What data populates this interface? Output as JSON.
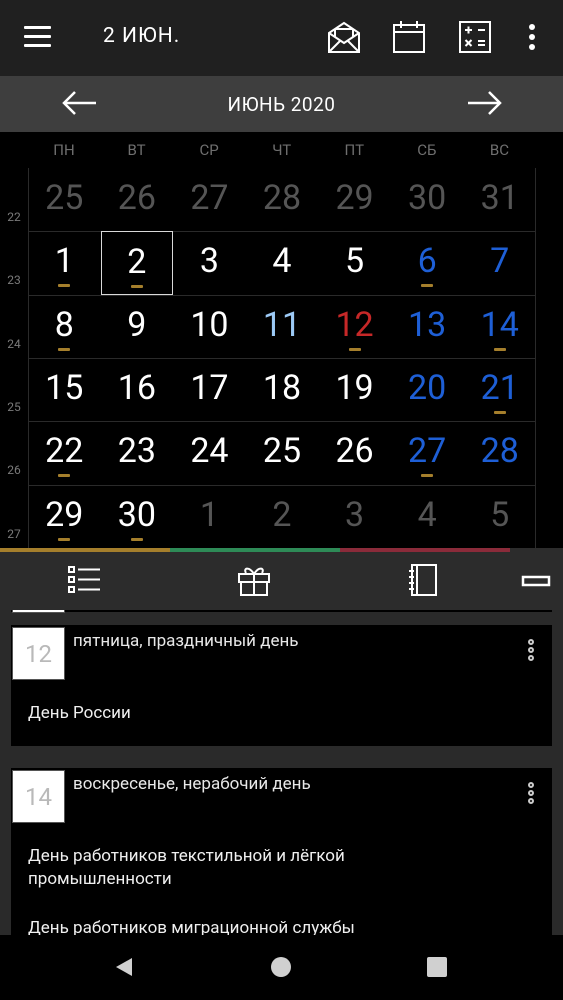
{
  "header": {
    "date": "2 ИЮН."
  },
  "month_bar": {
    "title": "ИЮНЬ 2020"
  },
  "weekdays": [
    "ПН",
    "ВТ",
    "СР",
    "ЧТ",
    "ПТ",
    "СБ",
    "ВС"
  ],
  "week_numbers": [
    "22",
    "23",
    "24",
    "25",
    "26",
    "27"
  ],
  "calendar": {
    "rows": [
      [
        "25",
        "26",
        "27",
        "28",
        "29",
        "30",
        "31"
      ],
      [
        "1",
        "2",
        "3",
        "4",
        "5",
        "6",
        "7"
      ],
      [
        "8",
        "9",
        "10",
        "11",
        "12",
        "13",
        "14"
      ],
      [
        "15",
        "16",
        "17",
        "18",
        "19",
        "20",
        "21"
      ],
      [
        "22",
        "23",
        "24",
        "25",
        "26",
        "27",
        "28"
      ],
      [
        "29",
        "30",
        "1",
        "2",
        "3",
        "4",
        "5"
      ]
    ],
    "selected": "2",
    "colors": {
      "normal": "#ffffff",
      "other_month": "#555555",
      "weekend": "#1e5fd6",
      "holiday": "#c62828",
      "pre_holiday": "#9cc9f5"
    }
  },
  "tab_colors": [
    "#a57f2c",
    "#2e8b57",
    "#8b2b3a"
  ],
  "events": [
    {
      "day": "12",
      "subtitle": "пятница, праздничный день",
      "items": [
        "День России"
      ]
    },
    {
      "day": "14",
      "subtitle": "воскресенье, нерабочий день",
      "items": [
        "День работников текстильной и лёгкой промышленности",
        "День работников миграционной службы"
      ]
    }
  ]
}
